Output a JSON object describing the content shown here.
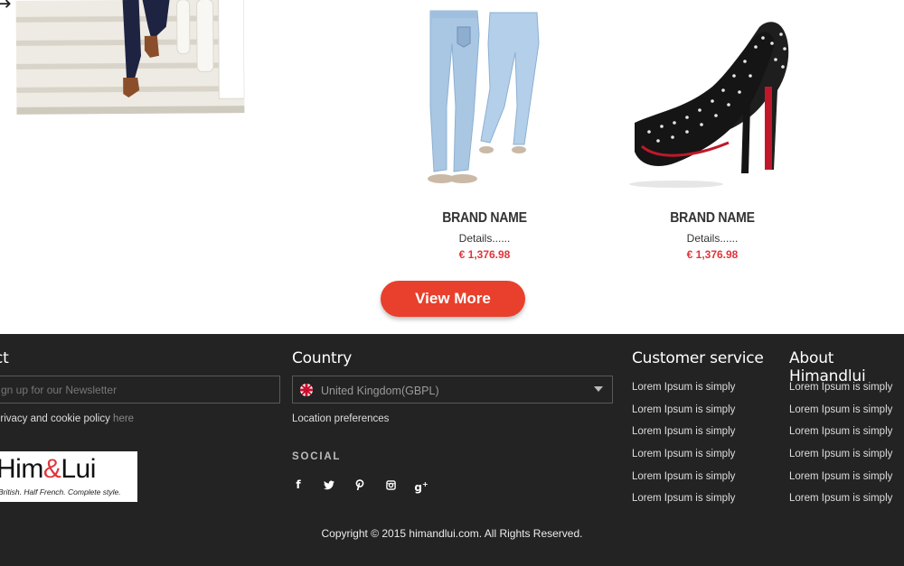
{
  "products": [
    {
      "brand": "BRAND NAME",
      "details": "Details......",
      "price": "€ 1,376.98",
      "image_icon": "jeans-photo"
    },
    {
      "brand": "BRAND NAME",
      "details": "Details......",
      "price": "€ 1,376.98",
      "image_icon": "studded-heels-photo"
    }
  ],
  "view_more_label": "View More",
  "footer": {
    "contact_heading": "ct",
    "newsletter_placeholder": "gn up for our Newsletter",
    "privacy_text": " privacy and cookie policy ",
    "privacy_link": "here",
    "logo": {
      "word_a": "Him",
      "amp": "&",
      "word_b": "Lui",
      "tagline": "British. Half French. Complete style."
    },
    "country_heading": "Country",
    "country_selected": "United Kingdom(GBPL)",
    "location_preferences": "Location preferences",
    "social_label": "SOCIAL",
    "social_icons": [
      "facebook-icon",
      "twitter-icon",
      "pinterest-icon",
      "instagram-icon",
      "google-plus-icon"
    ],
    "customer_service_heading": "Customer service",
    "customer_service_links": [
      "Lorem Ipsum is simply",
      "Lorem Ipsum is simply",
      "Lorem Ipsum is simply",
      "Lorem Ipsum is simply",
      "Lorem Ipsum is simply",
      "Lorem Ipsum is simply"
    ],
    "about_heading": "About Himandlui",
    "about_links": [
      "Lorem Ipsum is simply",
      "Lorem Ipsum is simply",
      "Lorem Ipsum is simply",
      "Lorem Ipsum is simply",
      "Lorem Ipsum is simply",
      "Lorem Ipsum is simply"
    ],
    "copyright": "Copyright © 2015 himandlui.com. All Rights Reserved."
  },
  "colors": {
    "accent": "#e8402c",
    "price": "#e0343a",
    "footer_bg": "#232323"
  }
}
